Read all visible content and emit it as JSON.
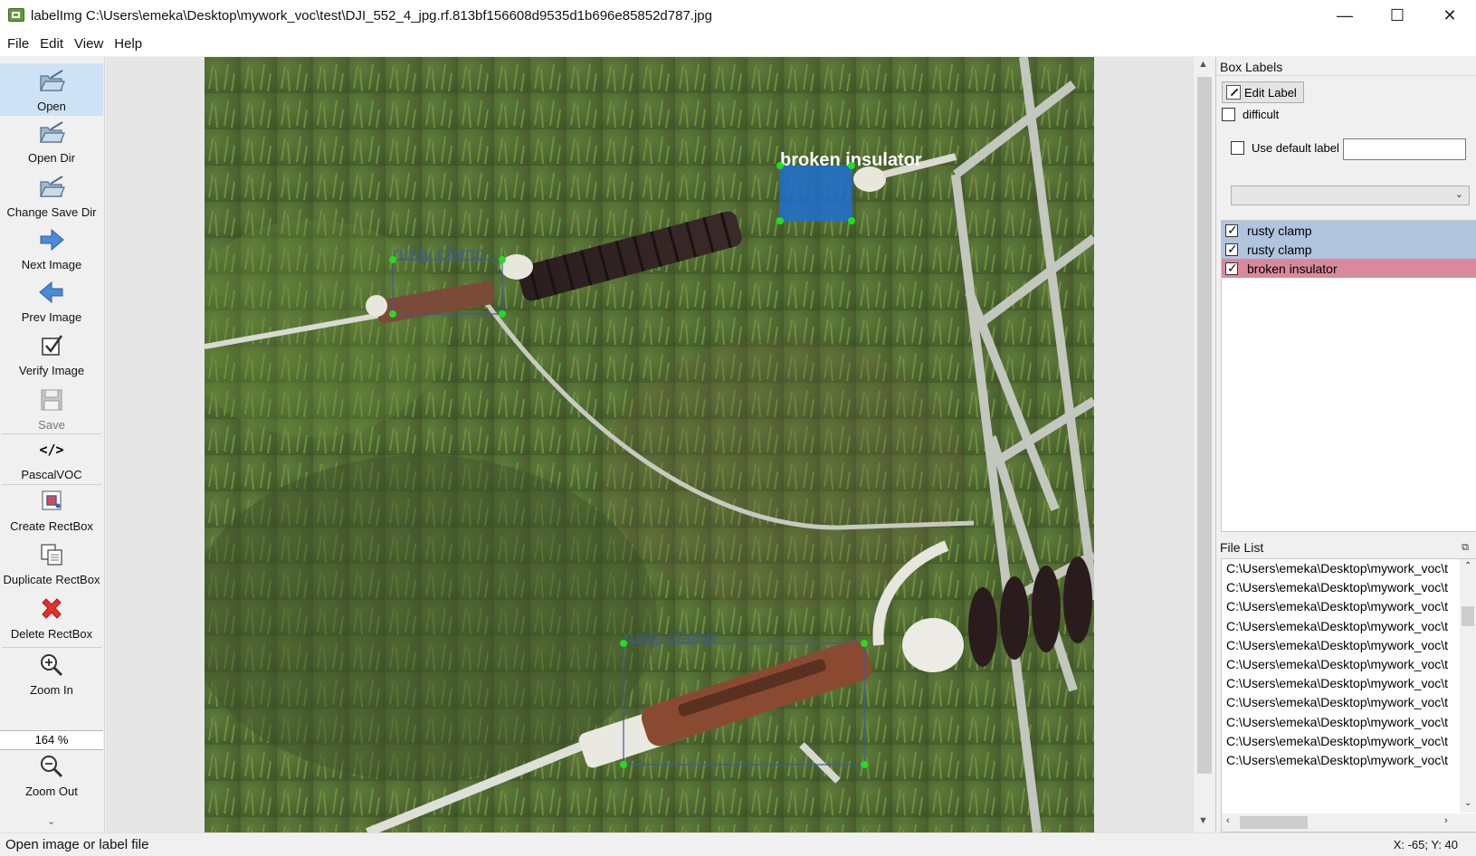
{
  "window": {
    "title": "labelImg C:\\Users\\emeka\\Desktop\\mywork_voc\\test\\DJI_552_4_jpg.rf.813bf156608d9535d1b696e85852d787.jpg",
    "minimize": "—",
    "maximize": "☐",
    "close": "✕"
  },
  "menu": {
    "file": "File",
    "edit": "Edit",
    "view": "View",
    "help": "Help"
  },
  "toolbar": {
    "open": "Open",
    "open_dir": "Open Dir",
    "change_save_dir": "Change Save Dir",
    "next_image": "Next Image",
    "prev_image": "Prev Image",
    "verify_image": "Verify Image",
    "save": "Save",
    "format_icon": "</>",
    "format": "PascalVOC",
    "create_rectbox": "Create RectBox",
    "duplicate_rectbox": "Duplicate RectBox",
    "delete_rectbox": "Delete RectBox",
    "zoom_in": "Zoom In",
    "zoom_value": "164 %",
    "zoom_out": "Zoom Out"
  },
  "canvas": {
    "boxes": [
      {
        "label": "rusty clamp",
        "color": "#3c5a9a",
        "fill": "none"
      },
      {
        "label": "broken insulator",
        "color": "#ffffff",
        "fill": "#1f6fd0"
      },
      {
        "label": "rusty clamp",
        "color": "#3c5a9a",
        "fill": "none"
      }
    ]
  },
  "box_labels": {
    "title": "Box Labels",
    "edit_label": "Edit Label",
    "difficult": "difficult",
    "use_default_label": "Use default label",
    "default_label_value": "",
    "items": [
      {
        "label": "rusty clamp",
        "checked": true,
        "color": "#b0c4de"
      },
      {
        "label": "rusty clamp",
        "checked": true,
        "color": "#b0c4de"
      },
      {
        "label": "broken insulator",
        "checked": true,
        "color": "#d9899c"
      }
    ]
  },
  "file_list": {
    "title": "File List",
    "items": [
      "C:\\Users\\emeka\\Desktop\\mywork_voc\\t",
      "C:\\Users\\emeka\\Desktop\\mywork_voc\\t",
      "C:\\Users\\emeka\\Desktop\\mywork_voc\\t",
      "C:\\Users\\emeka\\Desktop\\mywork_voc\\t",
      "C:\\Users\\emeka\\Desktop\\mywork_voc\\t",
      "C:\\Users\\emeka\\Desktop\\mywork_voc\\t",
      "C:\\Users\\emeka\\Desktop\\mywork_voc\\t",
      "C:\\Users\\emeka\\Desktop\\mywork_voc\\t",
      "C:\\Users\\emeka\\Desktop\\mywork_voc\\t",
      "C:\\Users\\emeka\\Desktop\\mywork_voc\\t",
      "C:\\Users\\emeka\\Desktop\\mywork_voc\\t"
    ]
  },
  "status": {
    "message": "Open image or label file",
    "coords": "X: -65; Y: 40"
  }
}
